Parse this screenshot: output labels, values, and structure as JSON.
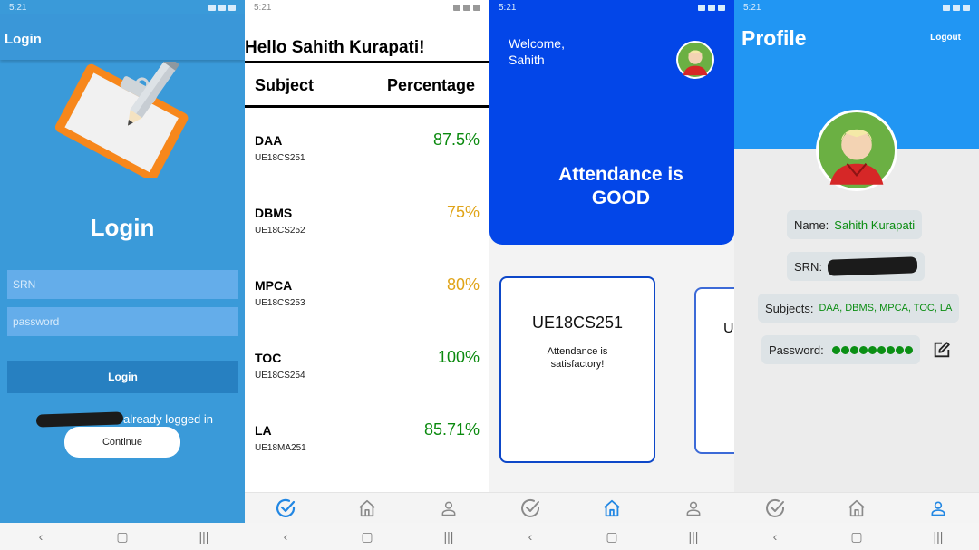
{
  "statusbar": {
    "time": "5:21"
  },
  "login_screen": {
    "header_title": "Login",
    "title": "Login",
    "srn_placeholder": "SRN",
    "password_placeholder": "password",
    "login_button": "Login",
    "already_logged_text": "already logged in",
    "continue_button": "Continue",
    "colors": {
      "background": "#3a9ad9",
      "button": "#2780c1"
    }
  },
  "attendance_screen": {
    "greeting": "Hello Sahith Kurapati!",
    "col_subject": "Subject",
    "col_percentage": "Percentage",
    "rows": [
      {
        "name": "DAA",
        "code": "UE18CS251",
        "percentage": "87.5%",
        "color": "#0b8a0f"
      },
      {
        "name": "DBMS",
        "code": "UE18CS252",
        "percentage": "75%",
        "color": "#e0a418"
      },
      {
        "name": "MPCA",
        "code": "UE18CS253",
        "percentage": "80%",
        "color": "#e0a418"
      },
      {
        "name": "TOC",
        "code": "UE18CS254",
        "percentage": "100%",
        "color": "#0b8a0f"
      },
      {
        "name": "LA",
        "code": "UE18MA251",
        "percentage": "85.71%",
        "color": "#0b8a0f"
      }
    ]
  },
  "home_screen": {
    "welcome": "Welcome,",
    "user_first_name": "Sahith",
    "status_line1": "Attendance is",
    "status_line2": "GOOD",
    "card_code": "UE18CS251",
    "card_message": "Attendance is satisfactory!",
    "next_card_code": "U",
    "colors": {
      "header": "#0346e8",
      "card_border": "#0d47c8"
    }
  },
  "profile_screen": {
    "title": "Profile",
    "logout": "Logout",
    "name_label": "Name:",
    "name_value": "Sahith Kurapati",
    "srn_label": "SRN:",
    "subjects_label": "Subjects:",
    "subjects_value": "DAA, DBMS, MPCA, TOC, LA",
    "password_label": "Password:",
    "password_dots": 9,
    "colors": {
      "header": "#2196f3",
      "value": "#0b8d12"
    }
  },
  "icons": {
    "tab_attendance": "check-circle-icon",
    "tab_home": "home-icon",
    "tab_profile": "person-icon",
    "edit": "edit-icon",
    "nav_back": "chevron-left-icon",
    "nav_home": "square-icon",
    "nav_recents": "recents-icon"
  }
}
